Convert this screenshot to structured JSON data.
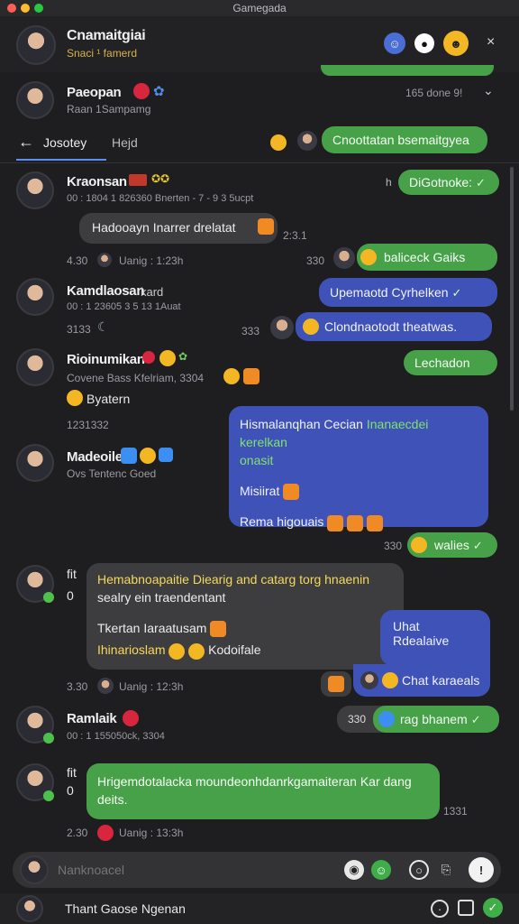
{
  "window": {
    "title": "Gamegada"
  },
  "header": {
    "name": "Cnamaitgiai",
    "subtitle": "Snaci ¹ famerd",
    "icons": [
      "user-icon",
      "camera-icon",
      "emoji-icon",
      "close-icon"
    ]
  },
  "pinned": {
    "name": "Paeopan",
    "subtitle": "Raan 1Sampamg",
    "right": "165 done 9!"
  },
  "tabs": {
    "tab1": "Josotey",
    "tab2": "Hejd",
    "top_green": "Cnoottatan bsemaitgyea"
  },
  "messages": {
    "m1": {
      "name": "Kraonsan",
      "meta": "00 : 1804 1 826360 Bnerten - 7 - 9 3 5ucpt",
      "bubble": "Hadooayn Inarrer drelatat",
      "time_a": "2:3.1",
      "time_b": "4.30",
      "status": "Uanig : 1:23h",
      "time_c": "330"
    },
    "right1": "DiGotnoke:",
    "right2": "baliceck Gaiks",
    "m2": {
      "name": "Kamdlaosan",
      "badge": "kard",
      "meta": "00 : 1 23605 3 5 13 1Auat",
      "time": "3133"
    },
    "right3": "Upemaotd Cyrhelken",
    "right4": "Clondnaotodt theatwas.",
    "right4_time": "333",
    "m3": {
      "name": "Rioinumikan",
      "meta": "Covene Bass Kfelriam, 3304",
      "line": "Byatern",
      "time": "1231332"
    },
    "right5": "Lechadon",
    "blue_big": {
      "line1": "Hismalanqhan Cecian",
      "line1b": "Inanaecdei kerelkan",
      "line2": "onasit",
      "line3": "Misiirat",
      "line4": "Rema higouais"
    },
    "m4": {
      "name": "Madeoile",
      "meta": "Ovs Tentenc Goed"
    },
    "right6": "walies",
    "right6_time": "330",
    "m5": {
      "initials": "fit",
      "zero": "0",
      "line1": "Hemabnoapaitie Diearig and catarg torg hnaenin",
      "line2": "sealry ein traendentant",
      "line3": "Tkertan Iaraatusam",
      "line4": "Ihinarioslam",
      "line4b": "Kodoifale",
      "time": "3.30",
      "status": "Uanig : 12:3h"
    },
    "right7": {
      "line1": "Uhat Rdealaive",
      "line2": "Chat karaeals"
    },
    "m6": {
      "name": "Ramlaik",
      "meta": "00 : 1 155050ck, 3304",
      "right": "rag bhanem",
      "right_time": "330"
    },
    "m7": {
      "initials": "fit",
      "zero": "0",
      "line1": "Hrigemdotalacka moundeonhdanrkgamaiteran Kar dang",
      "line2": "deits.",
      "time_r": "1331",
      "time": "2.30",
      "status": "Uanig : 13:3h"
    }
  },
  "composer": {
    "placeholder": "Nanknoacel"
  },
  "footer": {
    "label": "Thant Gaose Ngenan"
  }
}
